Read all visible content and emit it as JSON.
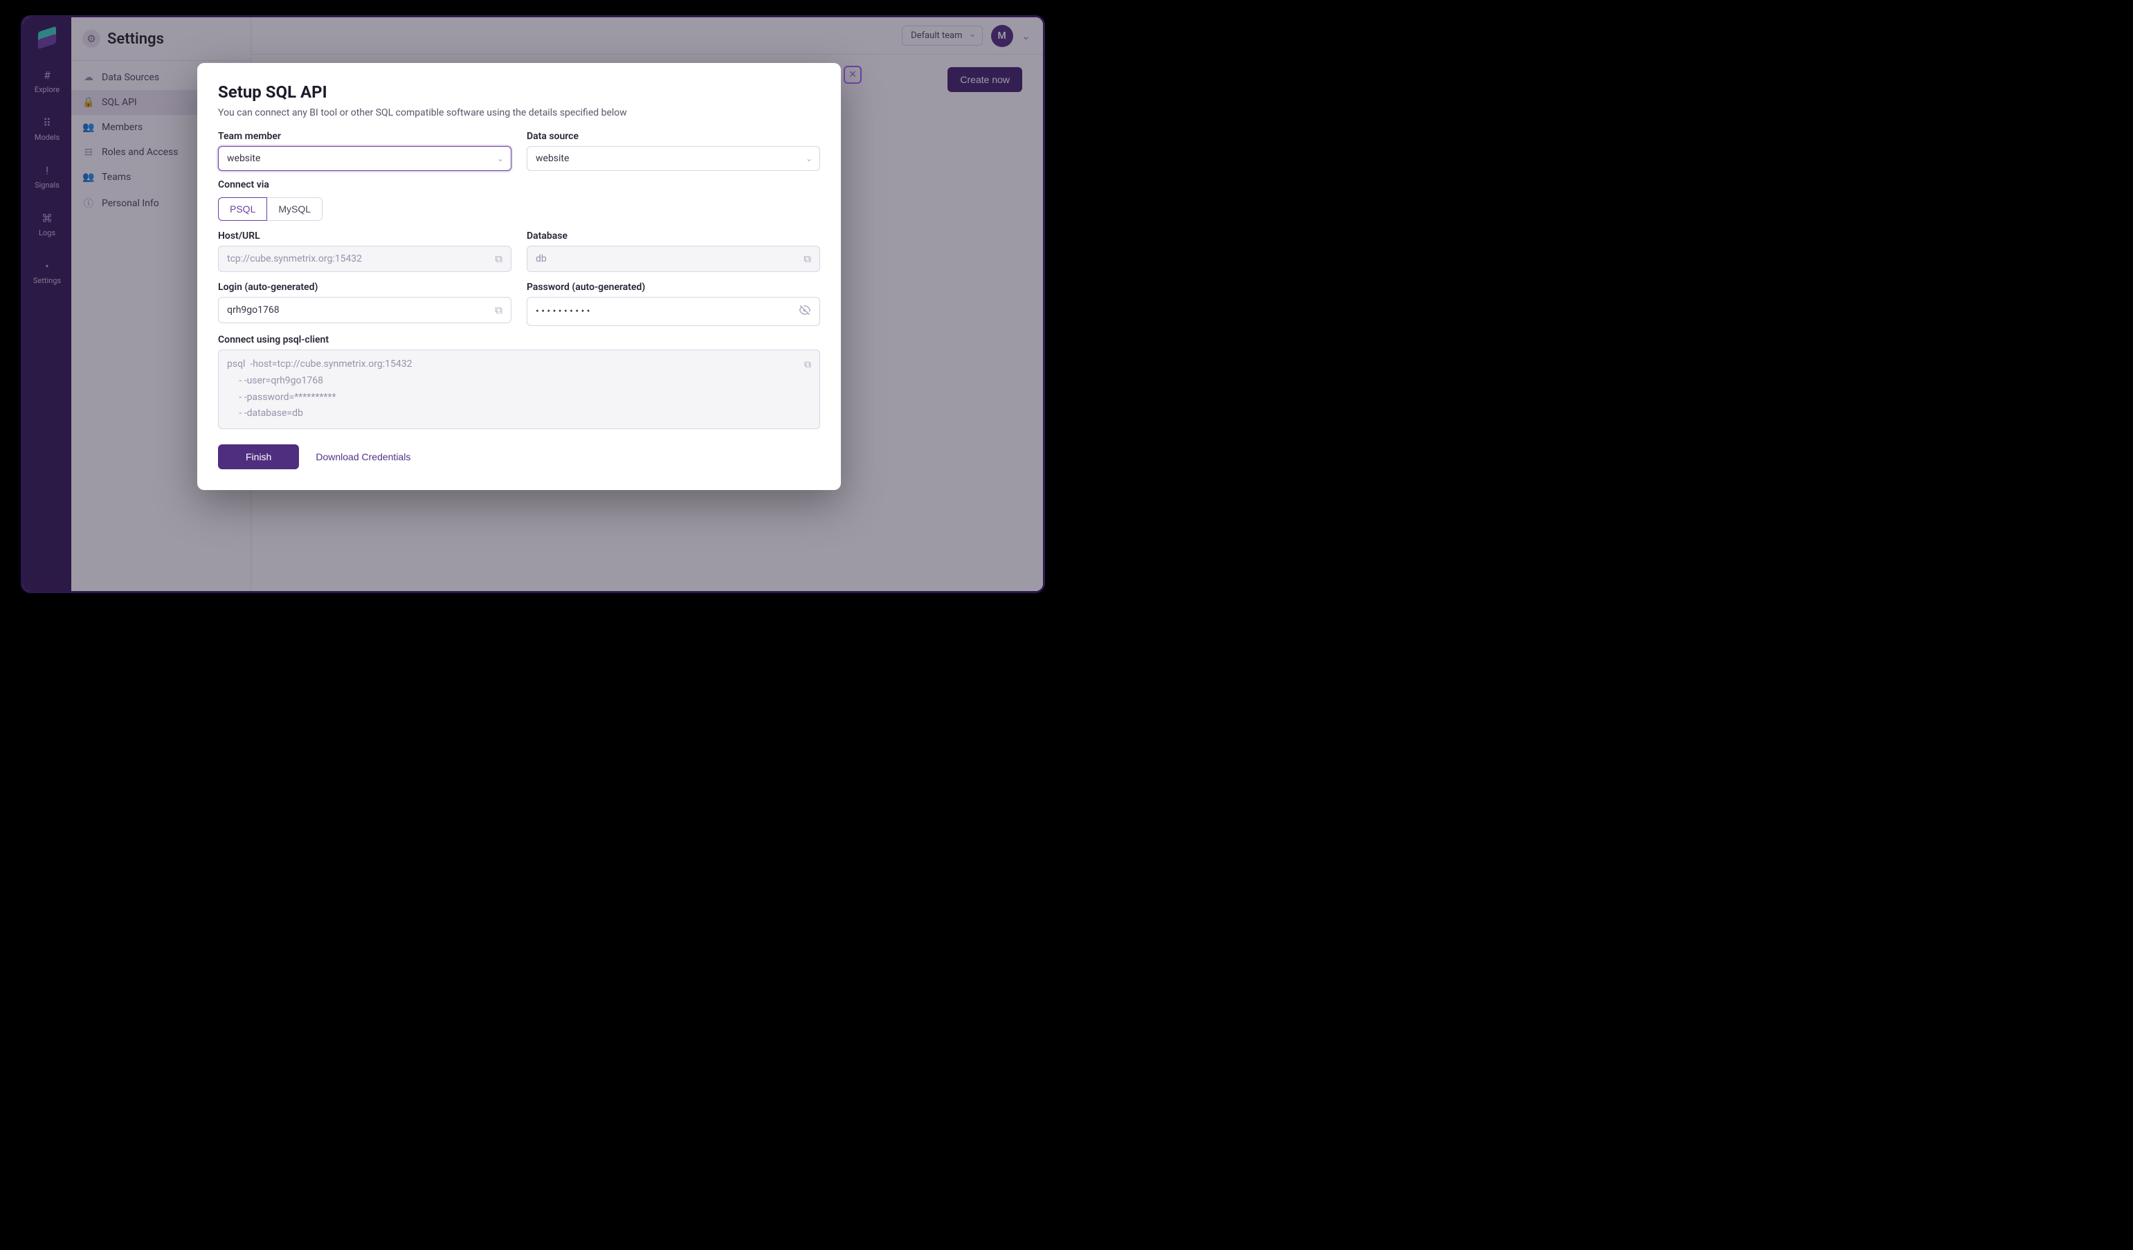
{
  "rail": {
    "items": [
      {
        "label": "Explore",
        "glyph": "#"
      },
      {
        "label": "Models",
        "glyph": "⠿"
      },
      {
        "label": "Signals",
        "glyph": "!"
      },
      {
        "label": "Logs",
        "glyph": "⌘"
      },
      {
        "label": "Settings",
        "glyph": "•"
      }
    ]
  },
  "settings": {
    "title": "Settings",
    "items": [
      {
        "label": "Data Sources",
        "glyph": "☁"
      },
      {
        "label": "SQL API",
        "glyph": "🔒"
      },
      {
        "label": "Members",
        "glyph": "👥"
      },
      {
        "label": "Roles and Access",
        "glyph": "⊟"
      },
      {
        "label": "Teams",
        "glyph": "👥"
      },
      {
        "label": "Personal Info",
        "glyph": "ⓘ"
      }
    ],
    "active_index": 1
  },
  "topbar": {
    "team_label": "Default team",
    "avatar_letter": "M"
  },
  "page": {
    "create_button": "Create now"
  },
  "modal": {
    "title": "Setup SQL API",
    "description": "You can connect any BI tool or other SQL compatible software using the details specified below",
    "team_member_label": "Team member",
    "team_member_value": "website",
    "data_source_label": "Data source",
    "data_source_value": "website",
    "connect_via_label": "Connect via",
    "connect_via_options": [
      "PSQL",
      "MySQL"
    ],
    "connect_via_selected": "PSQL",
    "host_label": "Host/URL",
    "host_value": "tcp://cube.synmetrix.org:15432",
    "database_label": "Database",
    "database_value": "db",
    "login_label": "Login (auto-generated)",
    "login_value": "qrh9go1768",
    "password_label": "Password (auto-generated)",
    "password_value": "• • • • • • • • • •",
    "psql_label": "Connect using psql-client",
    "psql_value": "psql  -host=tcp://cube.synmetrix.org:15432\n     - -user=qrh9go1768\n     - -password=**********\n     - -database=db",
    "finish_label": "Finish",
    "download_label": "Download Credentials",
    "close_glyph": "✕"
  }
}
